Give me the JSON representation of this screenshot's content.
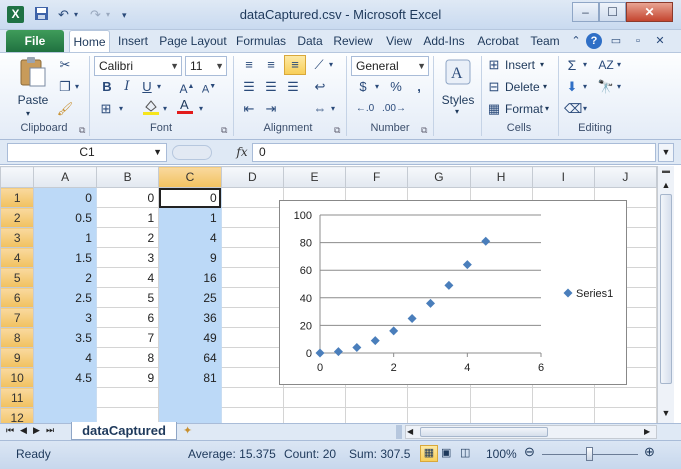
{
  "window": {
    "title": "dataCaptured.csv  -  Microsoft Excel",
    "app_icon": "X",
    "minimize": "–",
    "maximize": "☐",
    "close": "✕"
  },
  "ribbon_tabs": [
    "File",
    "Home",
    "Insert",
    "Page Layout",
    "Formulas",
    "Data",
    "Review",
    "View",
    "Add-Ins",
    "Acrobat",
    "Team"
  ],
  "active_tab": "Home",
  "clipboard": {
    "paste": "Paste",
    "label": "Clipboard"
  },
  "font": {
    "name": "Calibri",
    "size": "11",
    "label": "Font",
    "bold": "B",
    "italic": "I",
    "underline": "U"
  },
  "alignment": {
    "label": "Alignment"
  },
  "number": {
    "format": "General",
    "currency": "$",
    "percent": "%",
    "comma": ",",
    "label": "Number"
  },
  "styles": {
    "label": "Styles"
  },
  "cells": {
    "insert": "Insert",
    "delete": "Delete",
    "format": "Format",
    "label": "Cells"
  },
  "editing": {
    "label": "Editing",
    "sum": "Σ"
  },
  "formula_bar": {
    "name_box": "C1",
    "fx": "fx",
    "value": "0"
  },
  "columns": [
    "A",
    "B",
    "C",
    "D",
    "E",
    "F",
    "G",
    "H",
    "I",
    "J"
  ],
  "rows": [
    {
      "n": "1",
      "a": "0",
      "b": "0",
      "c": "0"
    },
    {
      "n": "2",
      "a": "0.5",
      "b": "1",
      "c": "1"
    },
    {
      "n": "3",
      "a": "1",
      "b": "2",
      "c": "4"
    },
    {
      "n": "4",
      "a": "1.5",
      "b": "3",
      "c": "9"
    },
    {
      "n": "5",
      "a": "2",
      "b": "4",
      "c": "16"
    },
    {
      "n": "6",
      "a": "2.5",
      "b": "5",
      "c": "25"
    },
    {
      "n": "7",
      "a": "3",
      "b": "6",
      "c": "36"
    },
    {
      "n": "8",
      "a": "3.5",
      "b": "7",
      "c": "49"
    },
    {
      "n": "9",
      "a": "4",
      "b": "8",
      "c": "64"
    },
    {
      "n": "10",
      "a": "4.5",
      "b": "9",
      "c": "81"
    },
    {
      "n": "11",
      "a": "",
      "b": "",
      "c": ""
    },
    {
      "n": "12",
      "a": "",
      "b": "",
      "c": ""
    }
  ],
  "chart_data": {
    "type": "scatter",
    "series": [
      {
        "name": "Series1",
        "x": [
          0,
          0.5,
          1,
          1.5,
          2,
          2.5,
          3,
          3.5,
          4,
          4.5
        ],
        "y": [
          0,
          1,
          4,
          9,
          16,
          25,
          36,
          49,
          64,
          81
        ]
      }
    ],
    "xlim": [
      0,
      6
    ],
    "ylim": [
      0,
      100
    ],
    "xticks": [
      0,
      2,
      4,
      6
    ],
    "yticks": [
      0,
      20,
      40,
      60,
      80,
      100
    ],
    "grid": "horizontal",
    "legend": "right",
    "marker_color": "#4a7ebb"
  },
  "sheet_tab": "dataCaptured",
  "status": {
    "ready": "Ready",
    "average": "Average: 15.375",
    "count": "Count: 20",
    "sum": "Sum: 307.5",
    "zoom": "100%"
  }
}
